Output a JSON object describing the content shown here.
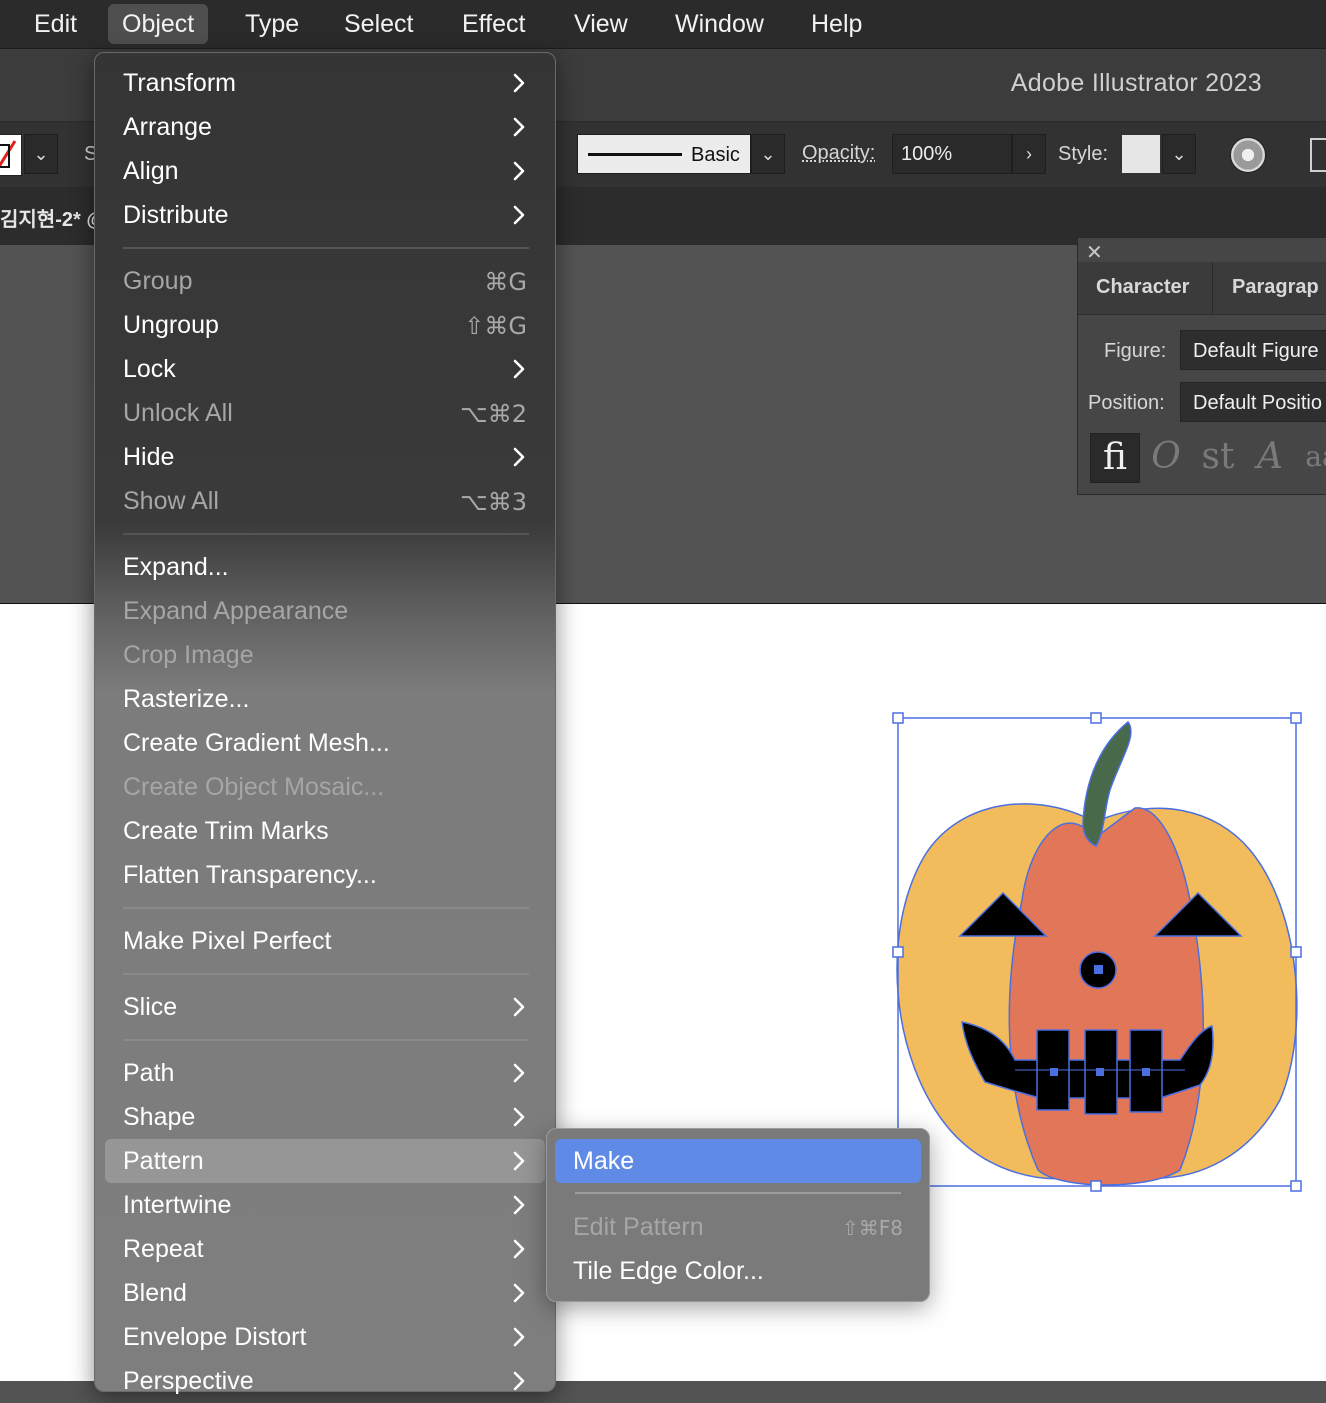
{
  "menubar": {
    "items": [
      "Edit",
      "Object",
      "Type",
      "Select",
      "Effect",
      "View",
      "Window",
      "Help"
    ],
    "active": "Object"
  },
  "app": {
    "title": "Adobe Illustrator 2023"
  },
  "controlbar": {
    "stroke_style": "Basic",
    "opacity_label": "Opacity:",
    "opacity_value": "100%",
    "style_label": "Style:",
    "partial_label": "S"
  },
  "document": {
    "tab_partial": "김지현-2* @"
  },
  "character_panel": {
    "tabs": [
      "Character",
      "Paragrap"
    ],
    "figure_label": "Figure:",
    "figure_value": "Default Figure",
    "position_label": "Position:",
    "position_value": "Default Positio",
    "opentype_buttons": [
      "fi",
      "O",
      "st",
      "A",
      "aa"
    ]
  },
  "object_menu": {
    "items": [
      {
        "label": "Transform",
        "submenu": true,
        "enabled": true
      },
      {
        "label": "Arrange",
        "submenu": true,
        "enabled": true
      },
      {
        "label": "Align",
        "submenu": true,
        "enabled": true
      },
      {
        "label": "Distribute",
        "submenu": true,
        "enabled": true
      },
      {
        "label": "Group",
        "shortcut": "⌘G",
        "enabled": false
      },
      {
        "label": "Ungroup",
        "shortcut": "⇧⌘G",
        "enabled": true
      },
      {
        "label": "Lock",
        "submenu": true,
        "enabled": true
      },
      {
        "label": "Unlock All",
        "shortcut": "⌥⌘2",
        "enabled": false
      },
      {
        "label": "Hide",
        "submenu": true,
        "enabled": true
      },
      {
        "label": "Show All",
        "shortcut": "⌥⌘3",
        "enabled": false
      },
      {
        "label": "Expand...",
        "enabled": true
      },
      {
        "label": "Expand Appearance",
        "enabled": false
      },
      {
        "label": "Crop Image",
        "enabled": false
      },
      {
        "label": "Rasterize...",
        "enabled": true
      },
      {
        "label": "Create Gradient Mesh...",
        "enabled": true
      },
      {
        "label": "Create Object Mosaic...",
        "enabled": false
      },
      {
        "label": "Create Trim Marks",
        "enabled": true
      },
      {
        "label": "Flatten Transparency...",
        "enabled": true
      },
      {
        "label": "Make Pixel Perfect",
        "enabled": true
      },
      {
        "label": "Slice",
        "submenu": true,
        "enabled": true
      },
      {
        "label": "Path",
        "submenu": true,
        "enabled": true
      },
      {
        "label": "Shape",
        "submenu": true,
        "enabled": true
      },
      {
        "label": "Pattern",
        "submenu": true,
        "enabled": true,
        "highlighted": true
      },
      {
        "label": "Intertwine",
        "submenu": true,
        "enabled": true
      },
      {
        "label": "Repeat",
        "submenu": true,
        "enabled": true
      },
      {
        "label": "Blend",
        "submenu": true,
        "enabled": true
      },
      {
        "label": "Envelope Distort",
        "submenu": true,
        "enabled": true
      },
      {
        "label": "Perspective",
        "submenu": true,
        "enabled": true
      }
    ]
  },
  "pattern_submenu": {
    "items": [
      {
        "label": "Make",
        "enabled": true,
        "selected": true
      },
      {
        "label": "Edit Pattern",
        "shortcut": "⇧⌘F8",
        "enabled": false
      },
      {
        "label": "Tile Edge Color...",
        "enabled": true
      }
    ]
  },
  "colors": {
    "highlight": "#5f8ae6",
    "selection": "#4a6fe0",
    "pumpkin_side": "#f2bb5c",
    "pumpkin_center": "#e27659",
    "stem": "#496a4a"
  }
}
